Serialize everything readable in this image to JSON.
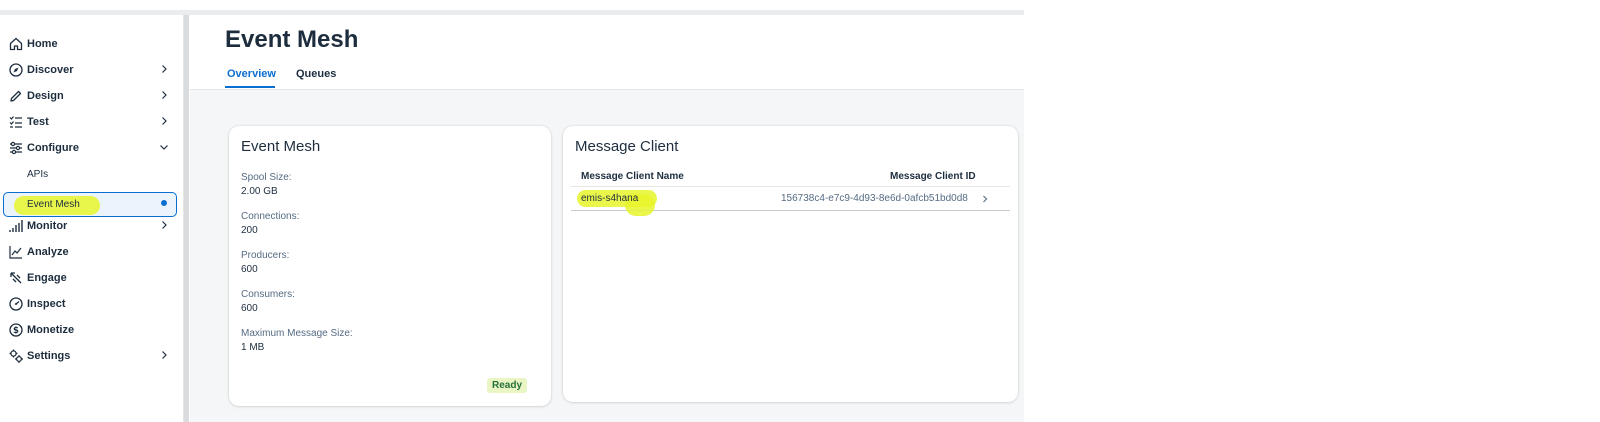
{
  "sidebar": {
    "items": [
      {
        "label": "Home",
        "icon": "home-icon",
        "has_chevron": false
      },
      {
        "label": "Discover",
        "icon": "compass-icon",
        "has_chevron": true
      },
      {
        "label": "Design",
        "icon": "pencil-icon",
        "has_chevron": true
      },
      {
        "label": "Test",
        "icon": "checklist-icon",
        "has_chevron": true
      },
      {
        "label": "Configure",
        "icon": "sliders-icon",
        "has_chevron": true,
        "expanded": true
      },
      {
        "label": "Monitor",
        "icon": "bar-chart-icon",
        "has_chevron": true
      },
      {
        "label": "Analyze",
        "icon": "line-chart-icon",
        "has_chevron": false
      },
      {
        "label": "Engage",
        "icon": "engage-icon",
        "has_chevron": false
      },
      {
        "label": "Inspect",
        "icon": "gauge-icon",
        "has_chevron": false
      },
      {
        "label": "Monetize",
        "icon": "dollar-icon",
        "has_chevron": false
      },
      {
        "label": "Settings",
        "icon": "gears-icon",
        "has_chevron": true
      }
    ],
    "configure_sub_items": [
      {
        "label": "APIs"
      },
      {
        "label": "Event Mesh",
        "selected": true
      }
    ]
  },
  "header": {
    "title": "Event Mesh",
    "tabs": [
      {
        "label": "Overview",
        "active": true
      },
      {
        "label": "Queues",
        "active": false
      }
    ]
  },
  "event_mesh_card": {
    "title": "Event Mesh",
    "fields": [
      {
        "label": "Spool Size:",
        "value": "2.00 GB"
      },
      {
        "label": "Connections:",
        "value": "200"
      },
      {
        "label": "Producers:",
        "value": "600"
      },
      {
        "label": "Consumers:",
        "value": "600"
      },
      {
        "label": "Maximum Message Size:",
        "value": "1 MB"
      }
    ],
    "status": "Ready"
  },
  "message_client_card": {
    "title": "Message Client",
    "columns": [
      "Message Client Name",
      "Message Client ID"
    ],
    "rows": [
      {
        "name": "emis-s4hana",
        "id": "156738c4-e7c9-4d93-8e6d-0afcb51bd0d8"
      }
    ]
  },
  "colors": {
    "accent": "#0a6ed1",
    "highlight": "#e8f52a",
    "ready_bg": "#eaf5c4",
    "ready_text": "#256f3a"
  }
}
